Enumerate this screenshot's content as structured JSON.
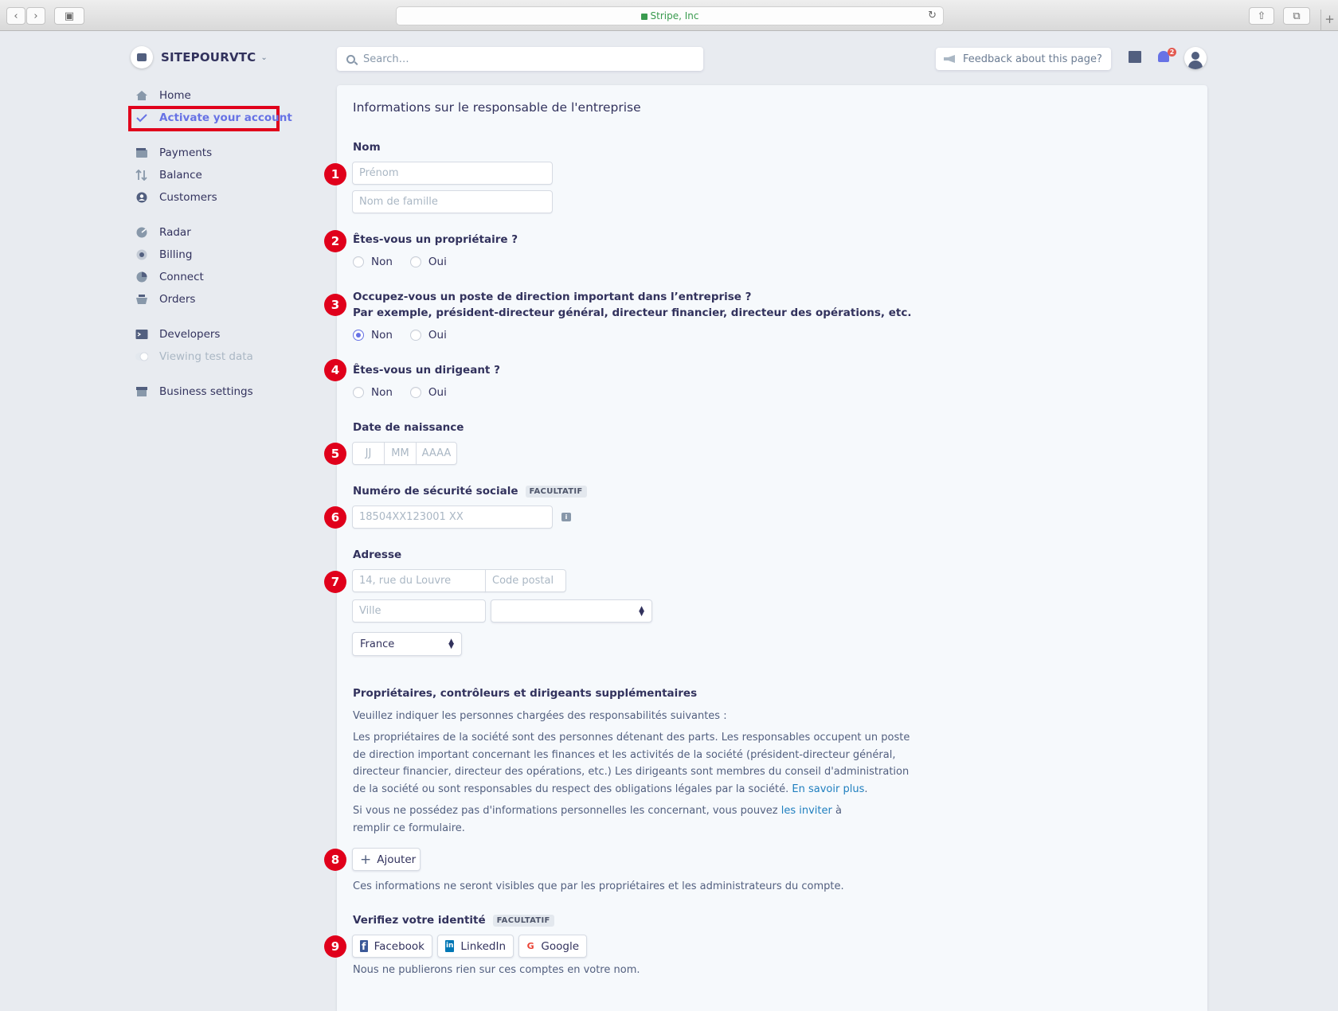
{
  "browser": {
    "url_text": "Stripe, Inc",
    "plus": "+"
  },
  "account": {
    "name": "SITEPOURVTC"
  },
  "nav": {
    "home": "Home",
    "activate": "Activate your account",
    "payments": "Payments",
    "balance": "Balance",
    "customers": "Customers",
    "radar": "Radar",
    "billing": "Billing",
    "connect": "Connect",
    "orders": "Orders",
    "developers": "Developers",
    "viewing_test": "Viewing test data",
    "business_settings": "Business settings"
  },
  "topbar": {
    "search_placeholder": "Search…",
    "feedback": "Feedback about this page?",
    "notification_count": "2"
  },
  "form": {
    "title": "Informations sur le responsable de l'entreprise",
    "nom_label": "Nom",
    "prenom_placeholder": "Prénom",
    "nom_famille_placeholder": "Nom de famille",
    "proprietaire_q": "Êtes-vous un propriétaire ?",
    "direction_q": "Occupez-vous un poste de direction important dans l’entreprise ?",
    "direction_hint": "Par exemple, président-directeur général, directeur financier, directeur des opérations, etc.",
    "dirigeant_q": "Êtes-vous un dirigeant ?",
    "non": "Non",
    "oui": "Oui",
    "dob_label": "Date de naissance",
    "dob_dd": "JJ",
    "dob_mm": "MM",
    "dob_yyyy": "AAAA",
    "ssn_label": "Numéro de sécurité sociale",
    "optional_tag": "FACULTATIF",
    "ssn_placeholder": "18504XX123001 XX",
    "info_icon": "i",
    "address_label": "Adresse",
    "street_placeholder": "14, rue du Louvre",
    "postal_placeholder": "Code postal",
    "city_placeholder": "Ville",
    "region_value": "",
    "country_value": "France",
    "extra_title": "Propriétaires, contrôleurs et dirigeants supplémentaires",
    "extra_intro": "Veuillez indiquer les personnes chargées des responsabilités suivantes :",
    "extra_body": "Les propriétaires de la société sont des personnes détenant des parts. Les responsables occupent un poste de direction important concernant les finances et les activités de la société (président-directeur général, directeur financier, directeur des opérations, etc.) Les dirigeants sont membres du conseil d'administration de la société ou sont responsables du respect des obligations légales par la société.",
    "learn_more": "En savoir plus",
    "invite_before": "Si vous ne possédez pas d'informations personnelles les concernant, vous pouvez",
    "invite_link": "les inviter",
    "invite_after": "à remplir ce formulaire.",
    "add_button": "Ajouter",
    "visibility_note": "Ces informations ne seront visibles que par les propriétaires et les administrateurs du compte.",
    "verify_label": "Verifiez votre identité",
    "facebook": "Facebook",
    "linkedin": "LinkedIn",
    "google": "Google",
    "publish_note": "Nous ne publierons rien sur ces comptes en votre nom."
  },
  "annotations": [
    "1",
    "2",
    "3",
    "4",
    "5",
    "6",
    "7",
    "8",
    "9"
  ],
  "colors": {
    "accent": "#6772e5",
    "marker": "#e0001b",
    "link": "#1f7fbf",
    "text": "#32325d"
  }
}
